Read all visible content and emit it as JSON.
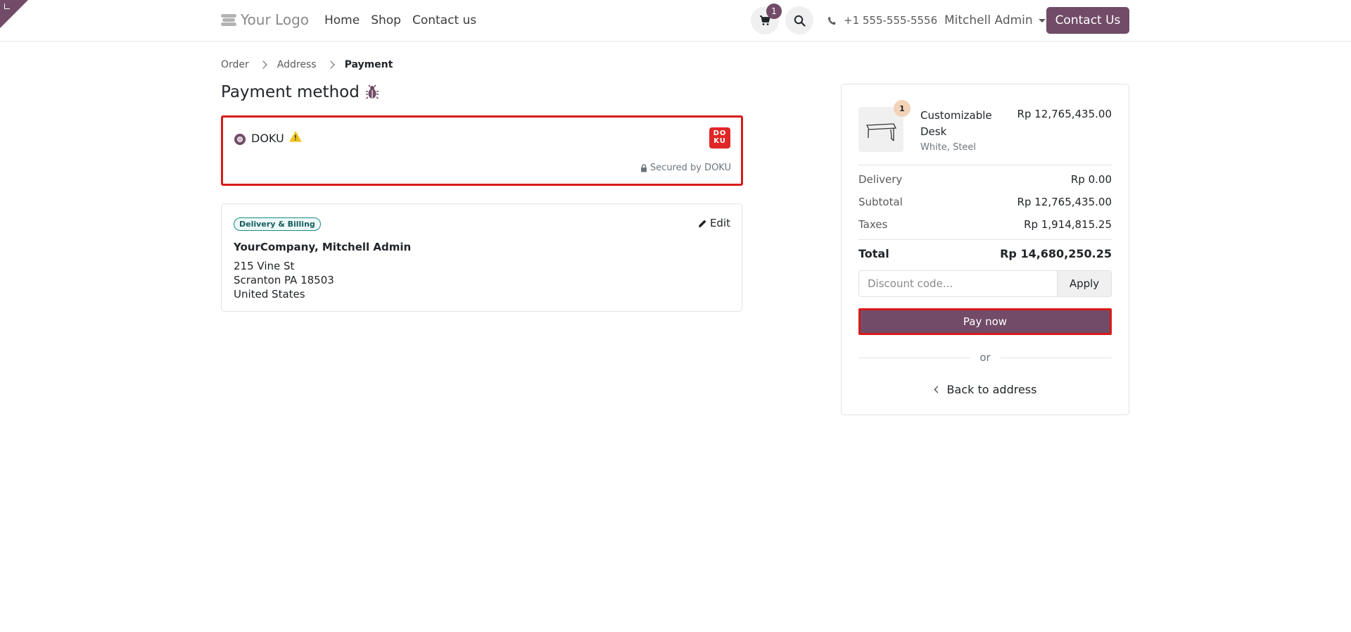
{
  "header": {
    "logo_text": "Your Logo",
    "nav": [
      "Home",
      "Shop",
      "Contact us"
    ],
    "cart_count": "1",
    "phone": "+1 555-555-5556",
    "user": "Mitchell Admin",
    "contact_button": "Contact Us"
  },
  "breadcrumb": [
    "Order",
    "Address",
    "Payment"
  ],
  "page_title": "Payment method",
  "payment_option": {
    "name": "DOKU",
    "logo_text_top": "DO",
    "logo_text_bottom": "KU",
    "secured_text": "Secured by DOKU"
  },
  "address": {
    "tag": "Delivery & Billing",
    "edit_label": "Edit",
    "name": "YourCompany, Mitchell Admin",
    "lines": [
      "215 Vine St",
      "Scranton PA 18503",
      "United States"
    ]
  },
  "summary": {
    "product": {
      "qty": "1",
      "name": "Customizable Desk",
      "variant": "White, Steel",
      "price": "Rp 12,765,435.00"
    },
    "delivery_label": "Delivery",
    "delivery_value": "Rp 0.00",
    "subtotal_label": "Subtotal",
    "subtotal_value": "Rp 12,765,435.00",
    "taxes_label": "Taxes",
    "taxes_value": "Rp 1,914,815.25",
    "total_label": "Total",
    "total_value": "Rp 14,680,250.25",
    "discount_placeholder": "Discount code...",
    "apply_label": "Apply",
    "pay_now_label": "Pay now",
    "or_label": "or",
    "back_label": "Back to address"
  },
  "colors": {
    "brand": "#714B67",
    "highlight": "#d81b1b"
  }
}
